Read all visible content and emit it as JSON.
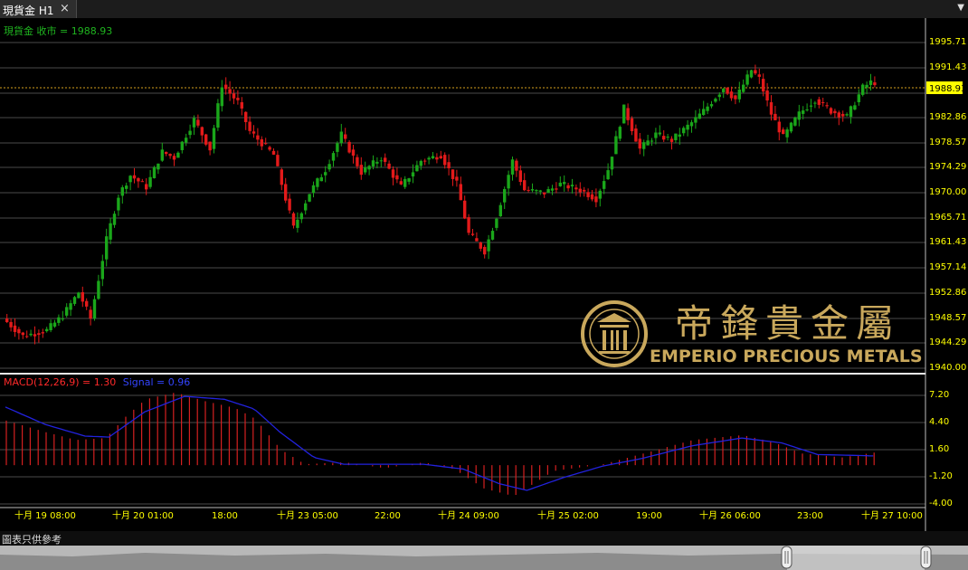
{
  "tab": {
    "label": "現貨金 H1",
    "close_icon": "×",
    "dropdown_icon": "▼"
  },
  "main_legend": "現貨金 收市 = 1988.93",
  "macd_legend": {
    "macd": "MACD(12,26,9) = 1.30",
    "signal": "Signal = 0.96"
  },
  "current_price": "1988.93",
  "price_axis": [
    "1995.71",
    "1991.43",
    "1982.86",
    "1978.57",
    "1974.29",
    "1970.00",
    "1965.71",
    "1961.43",
    "1957.14",
    "1952.86",
    "1948.57",
    "1944.29",
    "1940.00"
  ],
  "macd_axis": [
    "7.20",
    "4.40",
    "1.60",
    "-1.20",
    "-4.00"
  ],
  "time_axis": [
    "十月 19 08:00",
    "十月 20 01:00",
    "18:00",
    "十月 23 05:00",
    "22:00",
    "十月 24 09:00",
    "十月 25 02:00",
    "19:00",
    "十月 26 06:00",
    "23:00",
    "十月 27 10:00"
  ],
  "logo": {
    "cn": "帝鋒貴金屬",
    "en": "EMPERIO PRECIOUS METALS"
  },
  "footer": "圖表只供參考",
  "colors": {
    "up": "#1aa61a",
    "down": "#e31a1a",
    "signal": "#2222dd",
    "macd_bar": "#d42020",
    "price_line": "#d6a11e",
    "axis_text": "#ffff00",
    "logo": "#c9a85c"
  },
  "chart_data": {
    "type": "candlestick",
    "symbol": "現貨金",
    "timeframe": "H1",
    "ylim": [
      1940.0,
      1997.5
    ],
    "anchors": [
      [
        0,
        1948.5
      ],
      [
        10,
        1945.5
      ],
      [
        22,
        1946.5
      ],
      [
        30,
        1949.0
      ],
      [
        38,
        1953.0
      ],
      [
        44,
        1948.5
      ],
      [
        52,
        1962.0
      ],
      [
        58,
        1969.5
      ],
      [
        64,
        1973.0
      ],
      [
        72,
        1971.0
      ],
      [
        80,
        1977.0
      ],
      [
        86,
        1976.0
      ],
      [
        96,
        1982.5
      ],
      [
        104,
        1977.5
      ],
      [
        110,
        1988.5
      ],
      [
        118,
        1985.5
      ],
      [
        124,
        1980.5
      ],
      [
        136,
        1976.5
      ],
      [
        146,
        1964.0
      ],
      [
        154,
        1970.0
      ],
      [
        162,
        1974.0
      ],
      [
        170,
        1980.0
      ],
      [
        180,
        1973.5
      ],
      [
        190,
        1976.0
      ],
      [
        200,
        1971.0
      ],
      [
        210,
        1975.5
      ],
      [
        220,
        1976.5
      ],
      [
        228,
        1971.5
      ],
      [
        234,
        1963.0
      ],
      [
        242,
        1960.0
      ],
      [
        248,
        1966.0
      ],
      [
        256,
        1975.5
      ],
      [
        262,
        1970.5
      ],
      [
        272,
        1970.0
      ],
      [
        280,
        1971.5
      ],
      [
        290,
        1970.5
      ],
      [
        298,
        1969.0
      ],
      [
        304,
        1974.0
      ],
      [
        312,
        1984.5
      ],
      [
        320,
        1977.5
      ],
      [
        328,
        1980.0
      ],
      [
        336,
        1979.0
      ],
      [
        346,
        1982.0
      ],
      [
        352,
        1984.0
      ],
      [
        362,
        1988.0
      ],
      [
        368,
        1986.0
      ],
      [
        376,
        1991.0
      ],
      [
        380,
        1989.5
      ],
      [
        386,
        1983.5
      ],
      [
        392,
        1979.5
      ],
      [
        400,
        1983.5
      ],
      [
        408,
        1986.0
      ],
      [
        416,
        1984.0
      ],
      [
        424,
        1983.0
      ],
      [
        432,
        1988.0
      ],
      [
        436,
        1988.9
      ]
    ],
    "macd_anchors": [
      [
        0,
        4.6
      ],
      [
        20,
        3.4
      ],
      [
        35,
        2.6
      ],
      [
        50,
        2.8
      ],
      [
        60,
        5.0
      ],
      [
        70,
        6.8
      ],
      [
        85,
        7.5
      ],
      [
        100,
        6.6
      ],
      [
        115,
        5.9
      ],
      [
        125,
        4.8
      ],
      [
        138,
        1.6
      ],
      [
        150,
        0.1
      ],
      [
        170,
        0.3
      ],
      [
        190,
        -0.3
      ],
      [
        210,
        0.3
      ],
      [
        225,
        -0.4
      ],
      [
        240,
        -2.4
      ],
      [
        255,
        -3.2
      ],
      [
        275,
        -0.6
      ],
      [
        300,
        0.1
      ],
      [
        320,
        1.2
      ],
      [
        345,
        2.6
      ],
      [
        370,
        3.1
      ],
      [
        385,
        2.4
      ],
      [
        400,
        1.2
      ],
      [
        420,
        0.8
      ],
      [
        436,
        1.3
      ]
    ],
    "signal_anchors": [
      [
        0,
        6.0
      ],
      [
        20,
        4.2
      ],
      [
        40,
        3.0
      ],
      [
        52,
        2.9
      ],
      [
        70,
        5.5
      ],
      [
        90,
        7.1
      ],
      [
        110,
        6.8
      ],
      [
        125,
        5.8
      ],
      [
        138,
        3.4
      ],
      [
        155,
        0.8
      ],
      [
        170,
        0.1
      ],
      [
        190,
        0.1
      ],
      [
        210,
        0.1
      ],
      [
        230,
        -0.4
      ],
      [
        248,
        -1.9
      ],
      [
        262,
        -2.6
      ],
      [
        280,
        -1.3
      ],
      [
        300,
        -0.1
      ],
      [
        320,
        0.7
      ],
      [
        345,
        2.0
      ],
      [
        370,
        2.8
      ],
      [
        390,
        2.3
      ],
      [
        408,
        1.1
      ],
      [
        436,
        0.96
      ]
    ]
  }
}
